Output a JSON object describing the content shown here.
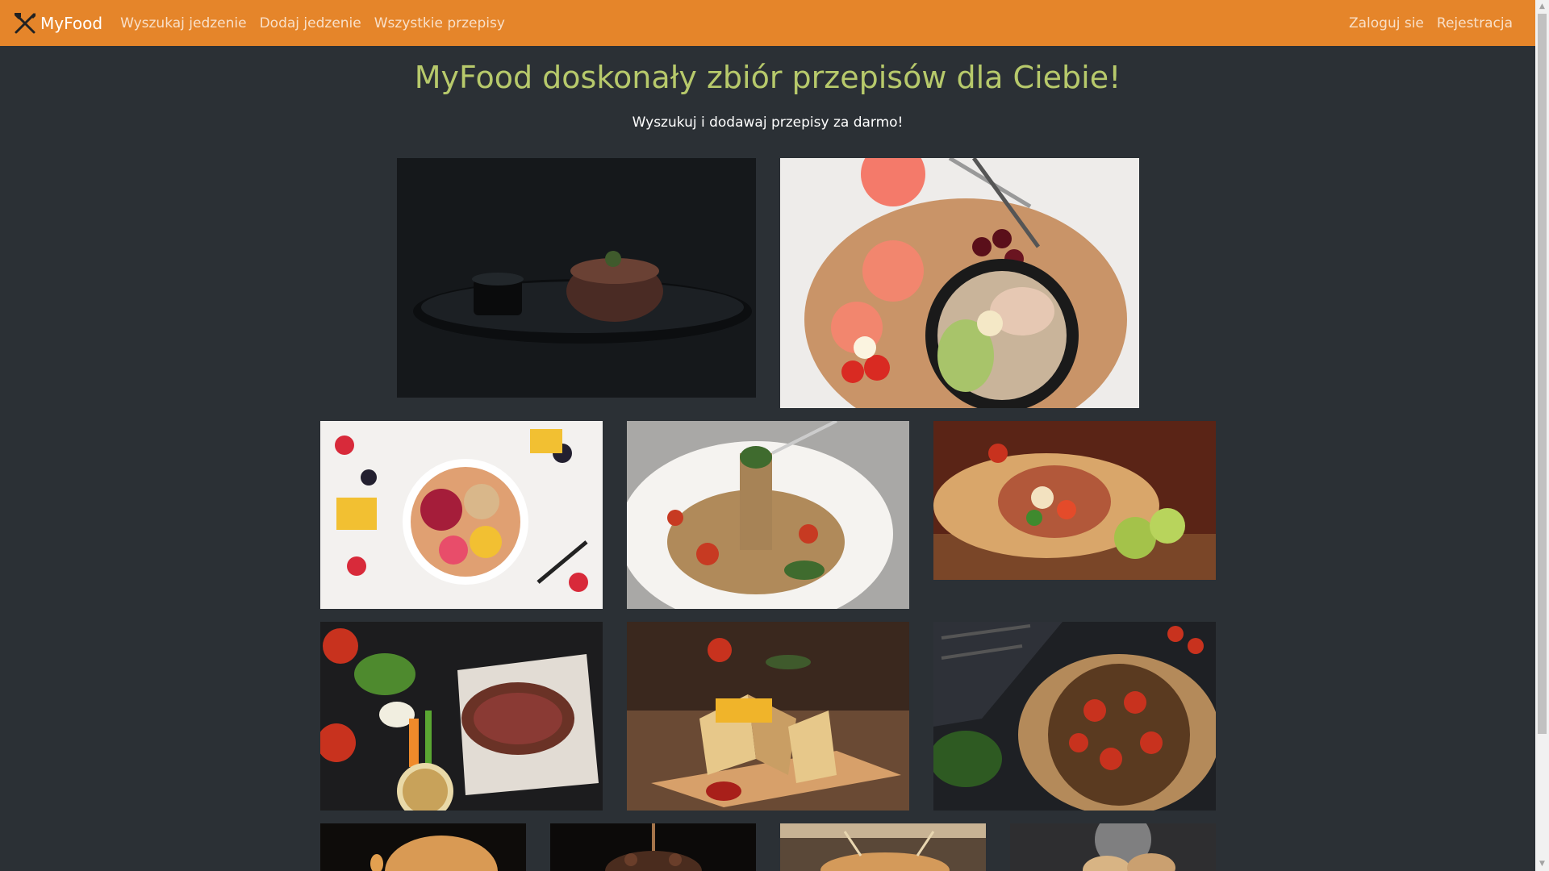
{
  "navbar": {
    "brand": "MyFood",
    "brand_icon": "fork-knife-icon",
    "links_left": [
      "Wyszukaj jedzenie",
      "Dodaj jedzenie",
      "Wszystkie przepisy"
    ],
    "links_right": [
      "Zaloguj sie",
      "Rejestracja"
    ],
    "accent_color": "#e5852a"
  },
  "hero": {
    "title": "MyFood doskonały zbiór przepisów dla Ciebie!",
    "subtitle": "Wyszukuj i dodawaj przepisy za darmo!",
    "title_color": "#b7c96b"
  },
  "gallery": {
    "images": [
      "steak-plate-image",
      "salad-grapefruit-image",
      "fruit-bowl-image",
      "spaghetti-image",
      "burrito-image",
      "sliced-steak-vegetables-image",
      "club-sandwich-image",
      "tomato-tart-image",
      "burger-image",
      "chocolate-dessert-image",
      "roasted-dish-image",
      "pastry-image"
    ]
  },
  "colors": {
    "background": "#2b3035"
  }
}
